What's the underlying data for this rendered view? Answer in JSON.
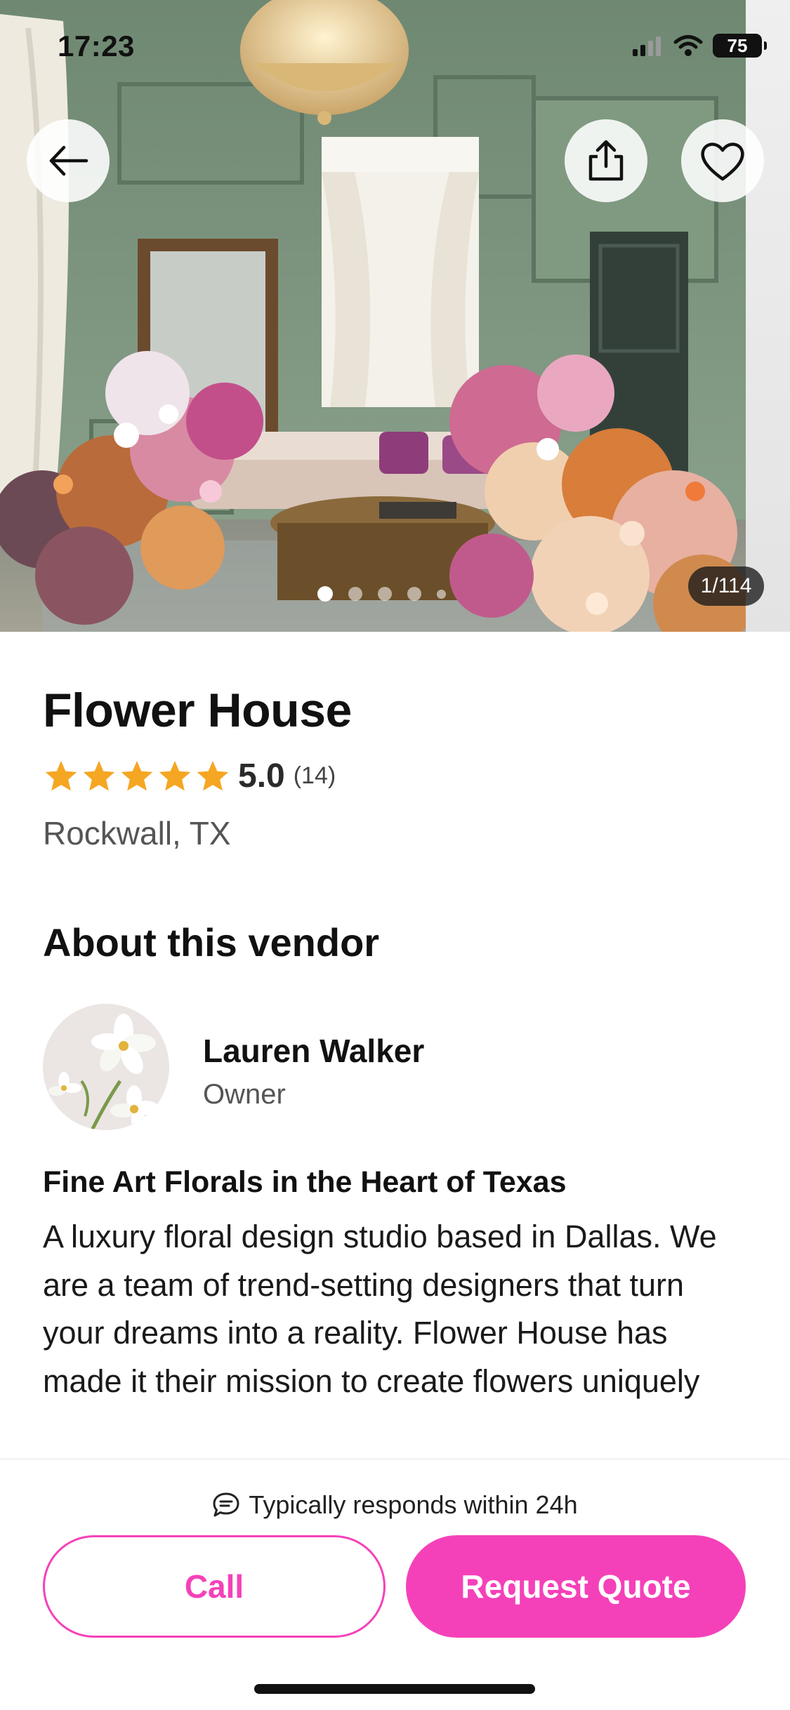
{
  "status_bar": {
    "time": "17:23",
    "battery": "75"
  },
  "hero": {
    "photo_counter": "1/114",
    "dot_count": 5,
    "active_dot": 0
  },
  "vendor": {
    "name": "Flower House",
    "rating": "5.0",
    "review_count": "(14)",
    "stars": 5,
    "location": "Rockwall, TX"
  },
  "about": {
    "section_title": "About this vendor",
    "owner_name": "Lauren Walker",
    "owner_role": "Owner",
    "tagline": "Fine Art Florals in the Heart of Texas",
    "description": "A luxury floral design studio based in Dallas. We are a team of trend-setting designers that turn your dreams into a reality. Flower House has made it their mission to create flowers uniquely tailored to every event,"
  },
  "bottom_bar": {
    "response_time": "Typically responds within 24h",
    "call_label": "Call",
    "quote_label": "Request Quote"
  },
  "colors": {
    "brand_pink": "#f541b9",
    "star_yellow": "#f5a623"
  }
}
